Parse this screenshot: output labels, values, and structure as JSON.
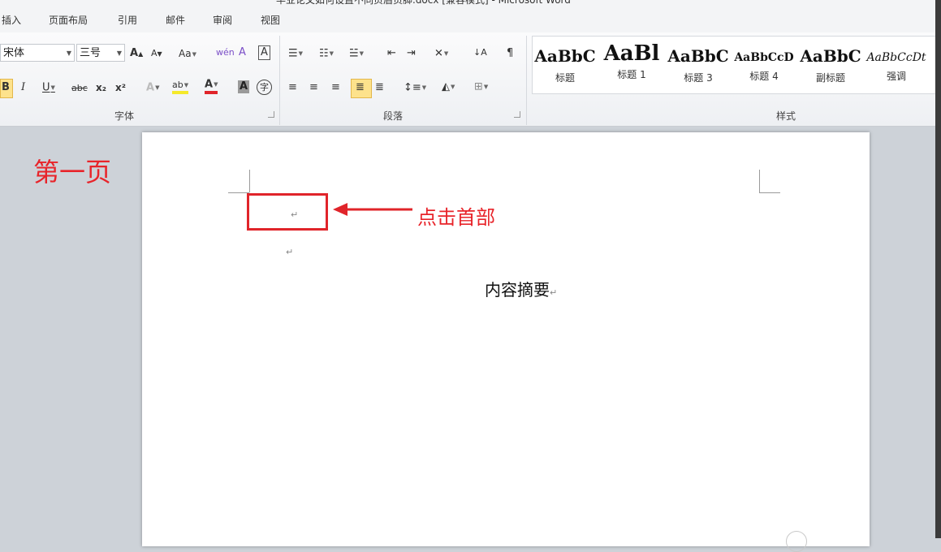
{
  "window": {
    "title": "毕业论文如何设置不同页眉页脚.docx [兼容模式] - Microsoft Word"
  },
  "menu": [
    "插入",
    "页面布局",
    "引用",
    "邮件",
    "审阅",
    "视图"
  ],
  "ribbon": {
    "font_group": {
      "label": "字体",
      "font_name": "宋体",
      "font_size": "三号",
      "grow_font": "A",
      "shrink_font": "A",
      "change_case": "Aa",
      "phonetic": "wén",
      "enclose_char": "A",
      "char_border": "A",
      "bold": "B",
      "italic": "I",
      "underline": "U",
      "strike": "abc",
      "subscript": "x₂",
      "superscript": "x²",
      "text_effect": "A",
      "highlight": "ab",
      "font_color": "A",
      "char_shading": "A",
      "enclose_circle": "字"
    },
    "paragraph_group": {
      "label": "段落"
    },
    "styles_group": {
      "label": "样式",
      "items": [
        {
          "preview": "AaBbC",
          "name": "标题"
        },
        {
          "preview": "AaBl",
          "name": "标题 1"
        },
        {
          "preview": "AaBbC",
          "name": "标题 3"
        },
        {
          "preview": "AaBbCcD",
          "name": "标题 4"
        },
        {
          "preview": "AaBbC",
          "name": "副标题"
        },
        {
          "preview": "AaBbCcDt",
          "name": "强调"
        }
      ]
    }
  },
  "document": {
    "pilcrow": "↵",
    "heading": "内容摘要"
  },
  "annotations": {
    "page_label": "第一页",
    "click_hint": "点击首部",
    "color": "#e8242a"
  }
}
